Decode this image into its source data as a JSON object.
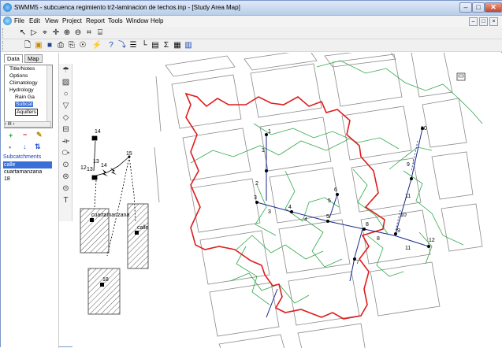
{
  "window": {
    "title": "SWMM5 - subcuenca regimiento tr2-laminacion de techos.inp - [Study Area Map]",
    "caption_buttons": {
      "minimize": "–",
      "maximize": "□",
      "close": "✕"
    }
  },
  "menu": {
    "items": [
      "File",
      "Edit",
      "View",
      "Project",
      "Report",
      "Tools",
      "Window",
      "Help"
    ],
    "mdi_buttons": [
      "–",
      "□",
      "×"
    ]
  },
  "left_panel": {
    "tabs": [
      "Data",
      "Map"
    ],
    "tree": [
      "Title/Notes",
      "Options",
      "Climatology",
      "Hydrology",
      "Rain Ga",
      "Subcat",
      "Aquifers"
    ],
    "scroll_label": "‹ III ›",
    "object_label": "Subcatchments",
    "list": [
      "calle",
      "cuartamanzana",
      "18"
    ],
    "selected_index": 0
  },
  "map": {
    "node_labels": [
      "1",
      "1",
      "2",
      "3",
      "3",
      "4",
      "4",
      "5",
      "5",
      "6",
      "7",
      "8",
      "8",
      "9",
      "9",
      "10",
      "10",
      "11",
      "11",
      "12",
      "13",
      "13",
      "14",
      "14",
      "15",
      "12"
    ],
    "subcatchment_labels": [
      "cuartamanzana",
      "calle",
      "18"
    ],
    "corner_icon": "map-print-icon"
  },
  "colors": {
    "boundary": "#e01c1c",
    "streets": "#8a8a8a",
    "flow": "#2fa84a",
    "conduit": "#1a2a8c",
    "selection": "#3a6fd8"
  }
}
